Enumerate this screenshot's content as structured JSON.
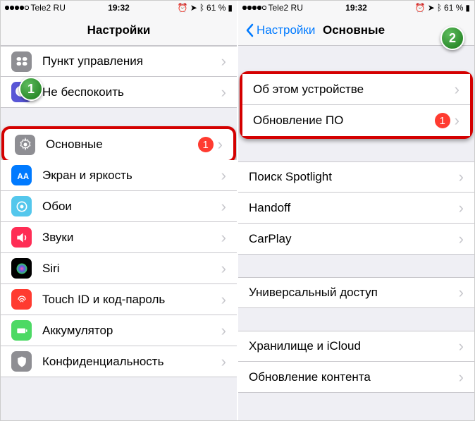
{
  "status": {
    "carrier": "Tele2 RU",
    "time": "19:32",
    "battery": "61 %"
  },
  "phone1": {
    "nav_title": "Настройки",
    "callout": "1",
    "items": [
      {
        "label": "Пункт управления",
        "icon_bg": "#8e8e93",
        "name": "control-center"
      },
      {
        "label": "Не беспокоить",
        "icon_bg": "#5856d6",
        "name": "do-not-disturb"
      },
      {
        "label": "Основные",
        "icon_bg": "#8e8e93",
        "badge": "1",
        "name": "general",
        "highlight": true
      },
      {
        "label": "Экран и яркость",
        "icon_bg": "#007aff",
        "name": "display"
      },
      {
        "label": "Обои",
        "icon_bg": "#54c7ec",
        "name": "wallpaper"
      },
      {
        "label": "Звуки",
        "icon_bg": "#ff2d55",
        "name": "sounds"
      },
      {
        "label": "Siri",
        "icon_bg": "#000",
        "name": "siri"
      },
      {
        "label": "Touch ID и код-пароль",
        "icon_bg": "#ff3b30",
        "name": "touch-id"
      },
      {
        "label": "Аккумулятор",
        "icon_bg": "#4cd964",
        "name": "battery"
      },
      {
        "label": "Конфиденциальность",
        "icon_bg": "#8e8e93",
        "name": "privacy"
      }
    ]
  },
  "phone2": {
    "back_label": "Настройки",
    "nav_title": "Основные",
    "callout": "2",
    "groups": [
      {
        "highlight": true,
        "items": [
          {
            "label": "Об этом устройстве",
            "name": "about"
          },
          {
            "label": "Обновление ПО",
            "badge": "1",
            "name": "software-update"
          }
        ]
      },
      {
        "items": [
          {
            "label": "Поиск Spotlight",
            "name": "spotlight"
          },
          {
            "label": "Handoff",
            "name": "handoff"
          },
          {
            "label": "CarPlay",
            "name": "carplay"
          }
        ]
      },
      {
        "items": [
          {
            "label": "Универсальный доступ",
            "name": "accessibility"
          }
        ]
      },
      {
        "items": [
          {
            "label": "Хранилище и iCloud",
            "name": "storage"
          },
          {
            "label": "Обновление контента",
            "name": "background-refresh"
          }
        ]
      }
    ]
  }
}
